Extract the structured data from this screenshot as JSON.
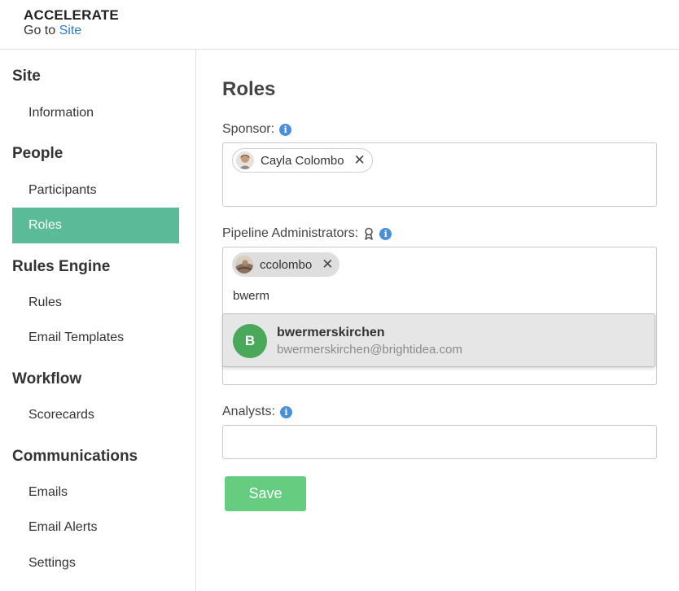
{
  "header": {
    "brand": "ACCELERATE",
    "goto_prefix": "Go to",
    "goto_link": "Site"
  },
  "sidebar": {
    "sections": [
      {
        "title": "Site",
        "items": [
          {
            "label": "Information"
          }
        ]
      },
      {
        "title": "People",
        "items": [
          {
            "label": "Participants"
          },
          {
            "label": "Roles",
            "active": true
          }
        ]
      },
      {
        "title": "Rules Engine",
        "items": [
          {
            "label": "Rules"
          },
          {
            "label": "Email Templates"
          }
        ]
      },
      {
        "title": "Workflow",
        "items": [
          {
            "label": "Scorecards"
          }
        ]
      },
      {
        "title": "Communications",
        "items": [
          {
            "label": "Emails"
          },
          {
            "label": "Email Alerts"
          },
          {
            "label": "Settings"
          }
        ]
      }
    ]
  },
  "main": {
    "title": "Roles",
    "sponsor": {
      "label": "Sponsor:",
      "chips": [
        {
          "name": "Cayla Colombo",
          "remove": "✕"
        }
      ]
    },
    "pipeline_admins": {
      "label": "Pipeline Administrators:",
      "chips": [
        {
          "name": "ccolombo",
          "remove": "✕"
        }
      ],
      "input_value": "bwerm"
    },
    "suggestion": {
      "avatar_letter": "B",
      "name": "bwermerskirchen",
      "email": "bwermerskirchen@brightidea.com"
    },
    "analysts": {
      "label": "Analysts:"
    },
    "save_label": "Save"
  },
  "colors": {
    "accent_active": "#5bba98",
    "link": "#2e7bc4",
    "save": "#66cc80",
    "avatar_green": "#4aa85a",
    "info": "#4a90d9"
  },
  "icons": {
    "info": "info-circle-icon",
    "ribbon": "award-ribbon-icon",
    "remove": "close-icon"
  }
}
